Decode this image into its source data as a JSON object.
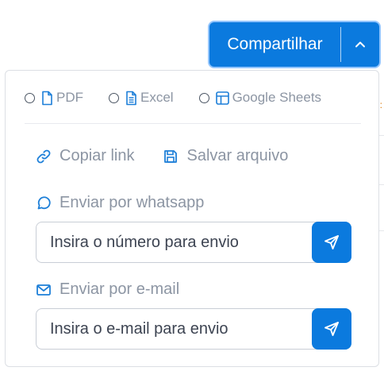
{
  "share_button": {
    "label": "Compartilhar"
  },
  "formats": [
    {
      "label": "PDF",
      "icon": "file-icon"
    },
    {
      "label": "Excel",
      "icon": "file-text-icon"
    },
    {
      "label": "Google Sheets",
      "icon": "layout-icon"
    }
  ],
  "actions": {
    "copy_link": "Copiar link",
    "save_file": "Salvar arquivo"
  },
  "whatsapp": {
    "label": "Enviar por whatsapp",
    "placeholder": "Insira o número para envio"
  },
  "email": {
    "label": "Enviar por e-mail",
    "placeholder": "Insira o e-mail para envio"
  },
  "colors": {
    "primary": "#0b7ade",
    "icon_blue": "#1d7fd8",
    "muted_text": "#8c95a3"
  }
}
